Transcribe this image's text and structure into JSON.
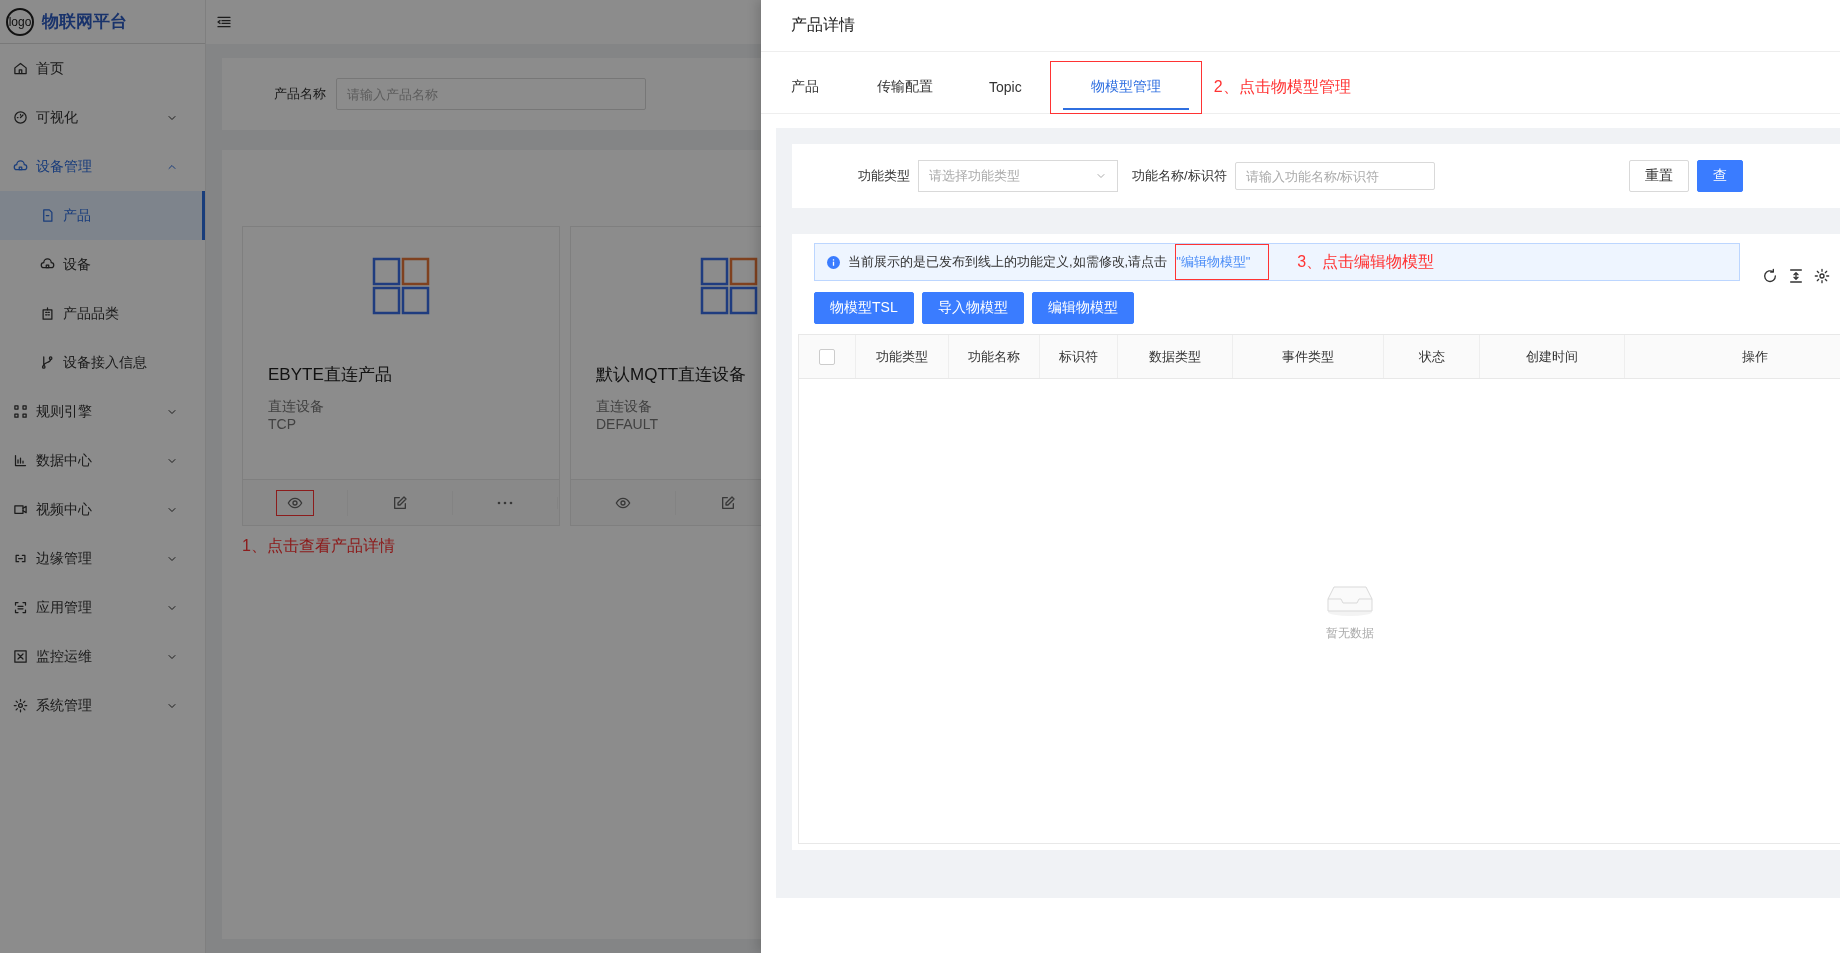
{
  "sidebar": {
    "logo": "logo",
    "title": "物联网平台",
    "items": [
      {
        "label": "首页"
      },
      {
        "label": "可视化",
        "expanded": false
      },
      {
        "label": "设备管理",
        "expanded": true,
        "children": [
          {
            "label": "产品",
            "selected": true
          },
          {
            "label": "设备",
            "selected": false
          },
          {
            "label": "产品品类",
            "selected": false
          },
          {
            "label": "设备接入信息",
            "selected": false
          }
        ]
      },
      {
        "label": "规则引擎",
        "expanded": false
      },
      {
        "label": "数据中心",
        "expanded": false
      },
      {
        "label": "视频中心",
        "expanded": false
      },
      {
        "label": "边缘管理",
        "expanded": false
      },
      {
        "label": "应用管理",
        "expanded": false
      },
      {
        "label": "监控运维",
        "expanded": false
      },
      {
        "label": "系统管理",
        "expanded": false
      }
    ]
  },
  "search": {
    "label": "产品名称",
    "placeholder": "请输入产品名称"
  },
  "products": [
    {
      "name": "EBYTE直连产品",
      "type": "直连设备",
      "protocol": "TCP",
      "actions": [
        {
          "kind": "view"
        },
        {
          "kind": "edit"
        },
        {
          "kind": "more"
        }
      ]
    },
    {
      "name": "默认MQTT直连设备",
      "type": "直连设备",
      "protocol": "DEFAULT",
      "actions": [
        {
          "kind": "view"
        },
        {
          "kind": "edit"
        }
      ]
    }
  ],
  "step_1": "1、点击查看产品详情",
  "drawer": {
    "title": "产品详情",
    "tabs": [
      {
        "label": "产品",
        "selected": false
      },
      {
        "label": "传输配置",
        "selected": false
      },
      {
        "label": "Topic",
        "selected": false
      },
      {
        "label": "物模型管理",
        "selected": true
      }
    ],
    "step_2": "2、点击物模型管理",
    "filters": {
      "type_label": "功能类型",
      "type_placeholder": "请选择功能类型",
      "name_label": "功能名称/标识符",
      "name_placeholder": "请输入功能名称/标识符"
    },
    "filter_buttons": [
      {
        "label": "重置",
        "kind": "default"
      },
      {
        "label": "查",
        "kind": "primary"
      }
    ],
    "alert": {
      "text": "当前展示的是已发布到线上的功能定义,如需修改,请点击",
      "link": "\"编辑物模型\""
    },
    "step_3": "3、点击编辑物模型",
    "actions": [
      "物模型TSL",
      "导入物模型",
      "编辑物模型"
    ],
    "table": {
      "select_all": {
        "checked": false
      },
      "columns": [
        "功能类型",
        "功能名称",
        "标识符",
        "数据类型",
        "事件类型",
        "状态",
        "创建时间",
        "操作"
      ],
      "empty_text": "暂无数据"
    }
  }
}
